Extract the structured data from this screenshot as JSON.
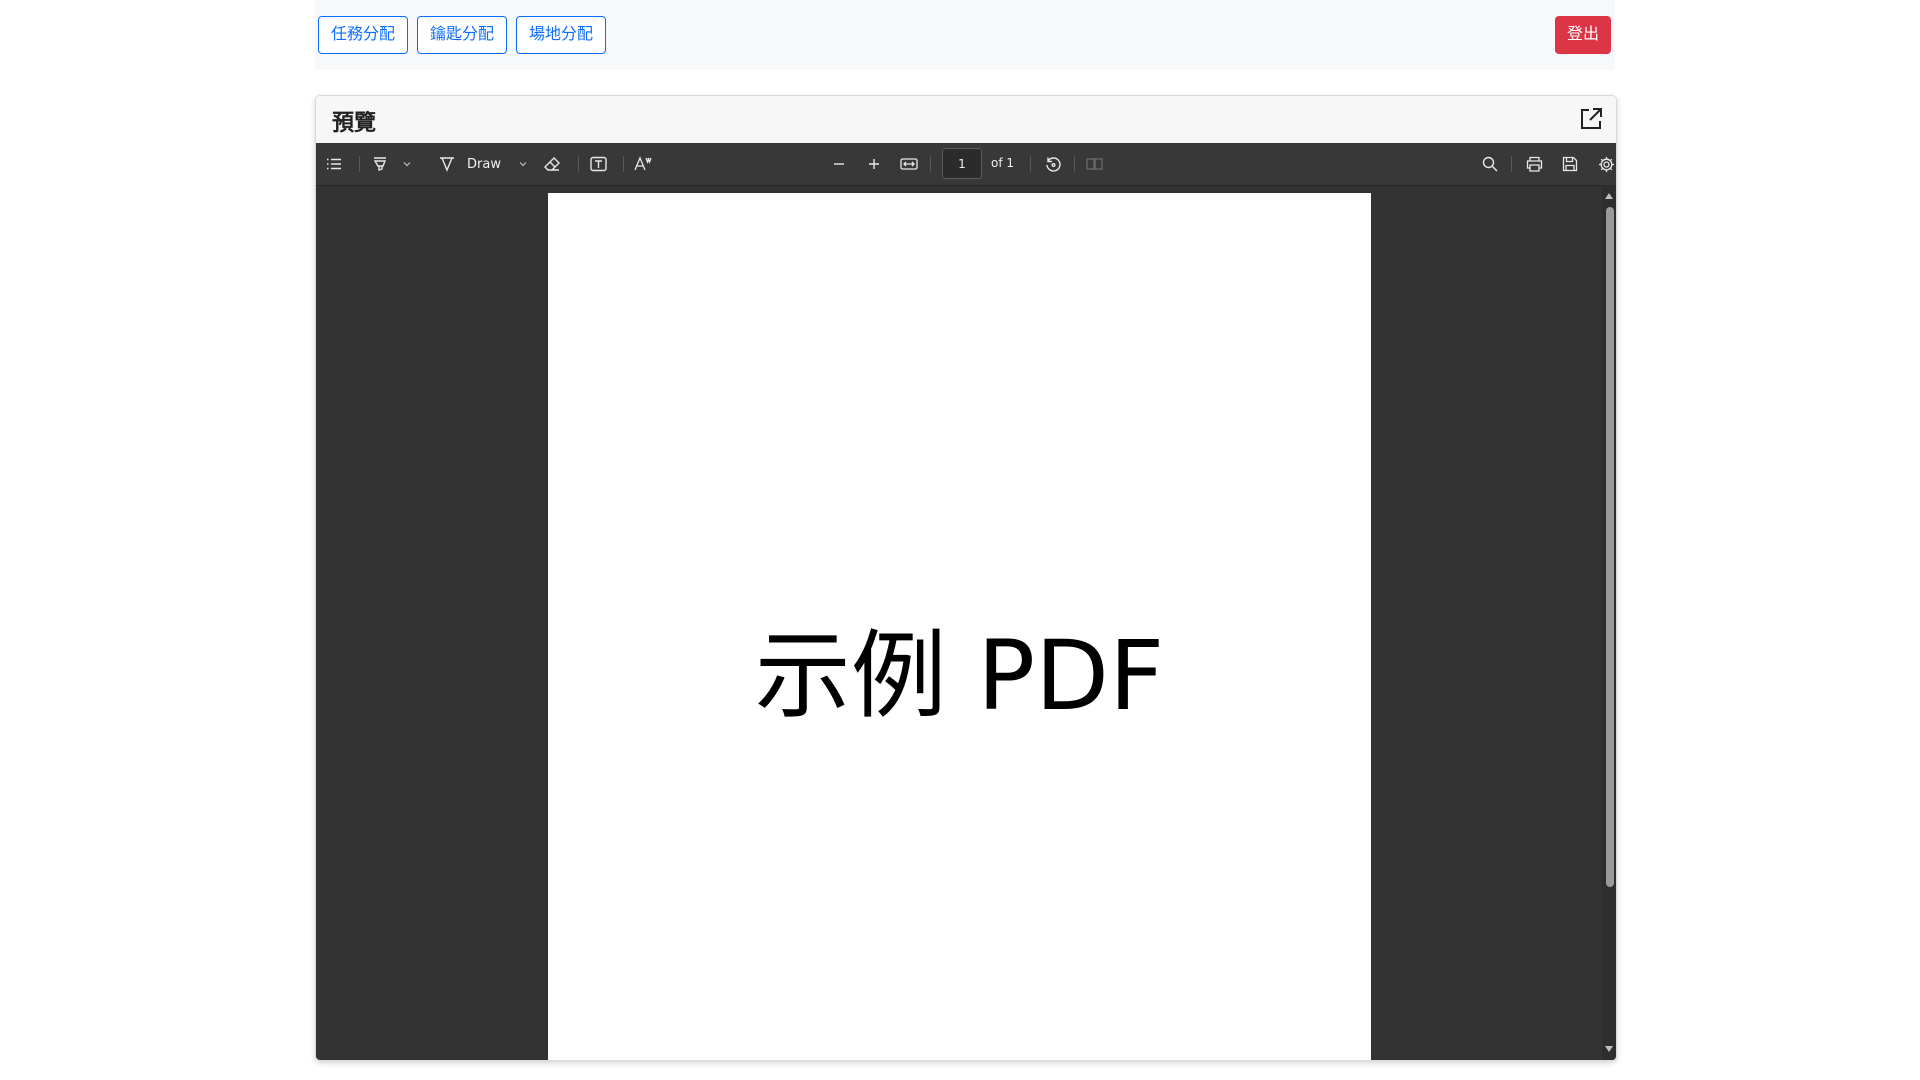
{
  "nav": {
    "buttons": [
      {
        "label": "任務分配"
      },
      {
        "label": "鑰匙分配"
      },
      {
        "label": "場地分配"
      }
    ],
    "logout_label": "登出"
  },
  "preview": {
    "title": "預覽",
    "toolbar": {
      "draw_label": "Draw",
      "page_value": "1",
      "page_count": "of 1"
    },
    "document": {
      "text": "示例 PDF"
    }
  },
  "colors": {
    "primary": "#0d6efd",
    "danger": "#dc3545",
    "viewer_bg": "#333333",
    "toolbar_bg": "#383838"
  },
  "icons": {
    "header": "open-in-new-window-icon",
    "toolbar": [
      "outline-icon",
      "highlight-icon",
      "draw-icon",
      "eraser-icon",
      "text-box-icon",
      "text-style-icon",
      "zoom-out-icon",
      "zoom-in-icon",
      "fit-page-icon",
      "rotate-icon",
      "two-page-icon",
      "search-icon",
      "print-icon",
      "save-icon",
      "settings-icon"
    ]
  }
}
